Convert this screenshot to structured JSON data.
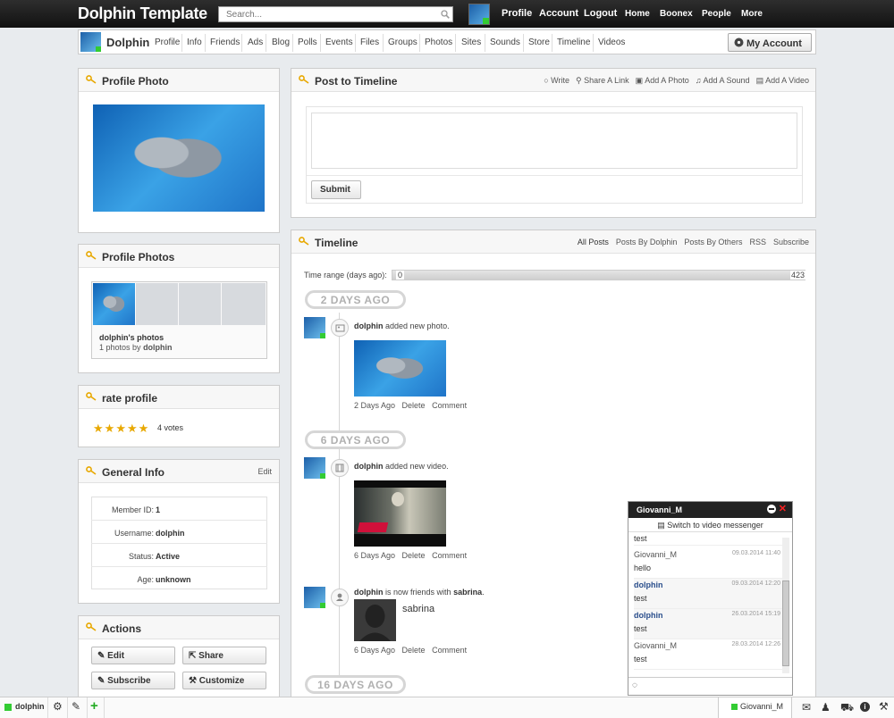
{
  "topbar": {
    "logo": "Dolphin Template",
    "search_placeholder": "Search...",
    "nav": [
      "Profile",
      "Account",
      "Logout",
      "Home",
      "Boonex",
      "People",
      "More"
    ]
  },
  "subbar": {
    "name": "Dolphin",
    "links": [
      "Profile",
      "Info",
      "Friends",
      "Ads",
      "Blog",
      "Polls",
      "Events",
      "Files",
      "Groups",
      "Photos",
      "Sites",
      "Sounds",
      "Store",
      "Timeline",
      "Videos"
    ],
    "my_account": "My Account"
  },
  "profile_photo": {
    "title": "Profile Photo"
  },
  "profile_photos": {
    "title": "Profile Photos",
    "album_title": "dolphin's photos",
    "album_meta_prefix": "1 photos by",
    "album_owner": "dolphin"
  },
  "rate": {
    "title": "rate profile",
    "votes": "4 votes",
    "stars": 5
  },
  "general_info": {
    "title": "General Info",
    "edit": "Edit",
    "fields": [
      {
        "label": "Member ID:",
        "value": "1"
      },
      {
        "label": "Username:",
        "value": "dolphin"
      },
      {
        "label": "Status:",
        "value": "Active"
      },
      {
        "label": "Age:",
        "value": "unknown"
      }
    ]
  },
  "actions": {
    "title": "Actions",
    "buttons": [
      "Edit",
      "Share",
      "Subscribe",
      "Customize"
    ]
  },
  "post": {
    "title": "Post to Timeline",
    "links": [
      "Write",
      "Share A Link",
      "Add A Photo",
      "Add A Sound",
      "Add A Video"
    ],
    "submit": "Submit"
  },
  "timeline": {
    "title": "Timeline",
    "filters": [
      "All Posts",
      "Posts By Dolphin",
      "Posts By Others",
      "RSS",
      "Subscribe"
    ],
    "range_label": "Time range (days ago):",
    "range_min": "0",
    "range_max": "423",
    "dates": [
      "2 DAYS AGO",
      "6 DAYS AGO",
      "16 DAYS AGO"
    ],
    "events": [
      {
        "actor": "dolphin",
        "text": "added new photo.",
        "meta": [
          "2 Days Ago",
          "Delete",
          "Comment"
        ]
      },
      {
        "actor": "dolphin",
        "text": "added new video.",
        "meta": [
          "6 Days Ago",
          "Delete",
          "Comment"
        ]
      },
      {
        "actor": "dolphin",
        "text": "is now friends with",
        "friend": "sabrina",
        "friend_label": "sabrina",
        "meta": [
          "6 Days Ago",
          "Delete",
          "Comment"
        ]
      }
    ]
  },
  "chat": {
    "title": "Giovanni_M",
    "switch": "Switch to video messenger",
    "partial": "test",
    "messages": [
      {
        "name": "Giovanni_M",
        "time": "09.03.2014 11:40",
        "text": "hello",
        "own": false
      },
      {
        "name": "dolphin",
        "time": "09.03.2014 12:20",
        "text": "test",
        "own": true
      },
      {
        "name": "dolphin",
        "time": "26.03.2014 15:19",
        "text": "test",
        "own": true
      },
      {
        "name": "Giovanni_M",
        "time": "28.03.2014 12:26",
        "text": "test",
        "own": false
      }
    ]
  },
  "bottombar": {
    "user": "dolphin",
    "chat_user": "Giovanni_M"
  },
  "colors": {
    "online": "#33cc33",
    "accent": "#e8a800",
    "chat_own": "#2a4e8c"
  }
}
